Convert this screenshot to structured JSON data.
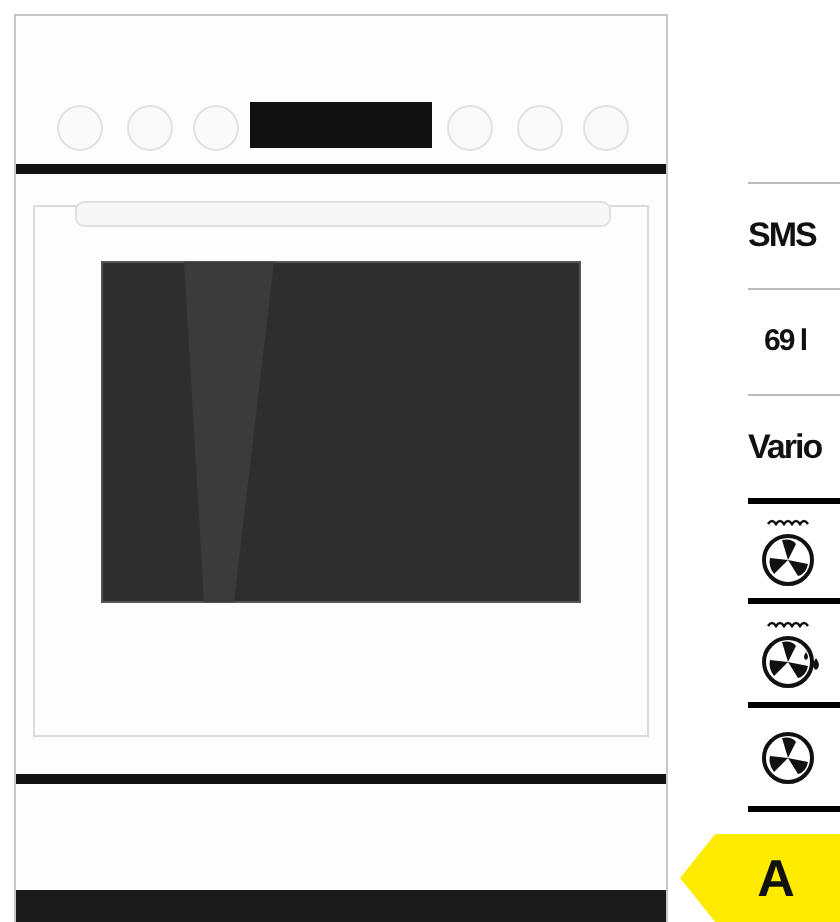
{
  "specs": [
    {
      "label": "SMS"
    },
    {
      "label": "69 l"
    },
    {
      "label": "Vario"
    }
  ],
  "energy_label": {
    "class": "A"
  }
}
